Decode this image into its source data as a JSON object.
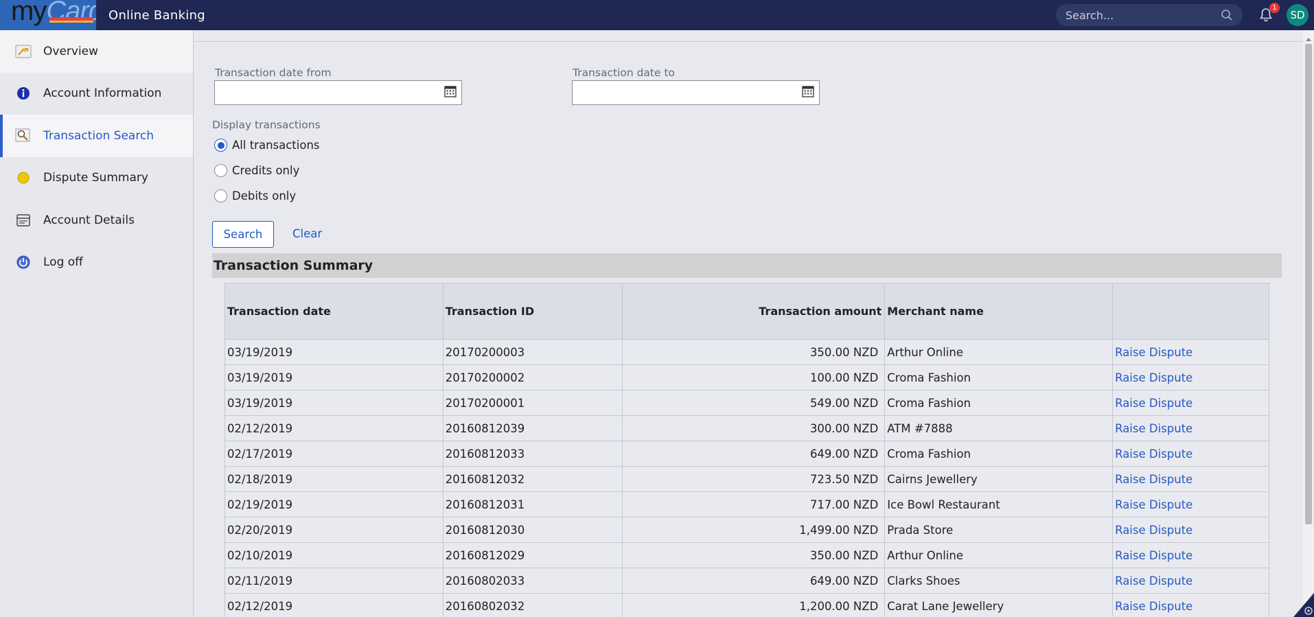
{
  "header": {
    "logo_prefix": "my",
    "logo_suffix": "Card",
    "app_title": "Online Banking",
    "search_placeholder": "Search...",
    "notification_count": "1",
    "user_initials": "SD"
  },
  "sidebar": {
    "items": [
      {
        "label": "Overview",
        "icon": "arrow-folder-icon"
      },
      {
        "label": "Account Information",
        "icon": "info-icon"
      },
      {
        "label": "Transaction Search",
        "icon": "magnifier-document-icon"
      },
      {
        "label": "Dispute Summary",
        "icon": "yellow-dot-icon"
      },
      {
        "label": "Account Details",
        "icon": "card-list-icon"
      },
      {
        "label": "Log off",
        "icon": "power-icon"
      }
    ],
    "active": "Transaction Search"
  },
  "filters": {
    "date_from_label": "Transaction date from",
    "date_from_value": "",
    "date_to_label": "Transaction date to",
    "date_to_value": "",
    "display_label": "Display transactions",
    "options": [
      "All transactions",
      "Credits only",
      "Debits only"
    ],
    "selected": "All transactions",
    "search_label": "Search",
    "clear_label": "Clear"
  },
  "summary": {
    "title": "Transaction Summary",
    "columns": [
      "Transaction date",
      "Transaction ID",
      "Transaction amount",
      "Merchant name",
      ""
    ],
    "action_label": "Raise Dispute",
    "rows": [
      {
        "date": "03/19/2019",
        "id": "20170200003",
        "amount": "350.00 NZD",
        "merchant": "Arthur Online"
      },
      {
        "date": "03/19/2019",
        "id": "20170200002",
        "amount": "100.00 NZD",
        "merchant": "Croma Fashion"
      },
      {
        "date": "03/19/2019",
        "id": "20170200001",
        "amount": "549.00 NZD",
        "merchant": "Croma Fashion"
      },
      {
        "date": "02/12/2019",
        "id": "20160812039",
        "amount": "300.00 NZD",
        "merchant": "ATM #7888"
      },
      {
        "date": "02/17/2019",
        "id": "20160812033",
        "amount": "649.00 NZD",
        "merchant": "Croma Fashion"
      },
      {
        "date": "02/18/2019",
        "id": "20160812032",
        "amount": "723.50 NZD",
        "merchant": "Cairns Jewellery"
      },
      {
        "date": "02/19/2019",
        "id": "20160812031",
        "amount": "717.00 NZD",
        "merchant": "Ice Bowl Restaurant"
      },
      {
        "date": "02/20/2019",
        "id": "20160812030",
        "amount": "1,499.00 NZD",
        "merchant": "Prada Store"
      },
      {
        "date": "02/10/2019",
        "id": "20160812029",
        "amount": "350.00 NZD",
        "merchant": "Arthur Online"
      },
      {
        "date": "02/11/2019",
        "id": "20160802033",
        "amount": "649.00 NZD",
        "merchant": "Clarks Shoes"
      },
      {
        "date": "02/12/2019",
        "id": "20160802032",
        "amount": "1,200.00 NZD",
        "merchant": "Carat Lane Jewellery"
      }
    ]
  },
  "colors": {
    "header_bg": "#1f2854",
    "accent": "#2558c4",
    "avatar_bg": "#0e8a7d",
    "badge": "#e23b3b"
  }
}
